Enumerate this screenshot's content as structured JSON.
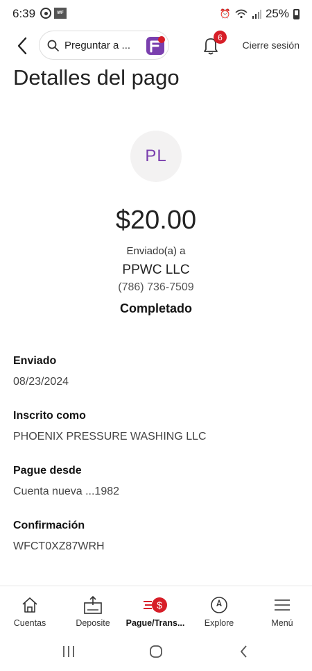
{
  "status_bar": {
    "time": "6:39",
    "wf_badge": "WF",
    "battery": "25%",
    "icons": [
      "whatsapp-icon",
      "wf-badge-icon",
      "alarm-icon",
      "wifi-icon",
      "signal-icon",
      "battery-icon"
    ]
  },
  "header": {
    "search_placeholder": "Preguntar a ...",
    "notification_count": "6",
    "logout_label": "Cierre sesión",
    "accent_color": "#d71e28",
    "fargo_color": "#7a3fae"
  },
  "page": {
    "title": "Detalles del pago"
  },
  "payment": {
    "avatar_initials": "PL",
    "amount": "$20.00",
    "sent_to_label": "Enviado(a) a",
    "payee_name": "PPWC LLC",
    "payee_phone": "(786) 736-7509",
    "status": "Completado"
  },
  "details": [
    {
      "label": "Enviado",
      "value": "08/23/2024"
    },
    {
      "label": "Inscrito como",
      "value": "PHOENIX PRESSURE WASHING LLC"
    },
    {
      "label": "Pague desde",
      "value": "Cuenta nueva ...1982"
    },
    {
      "label": "Confirmación",
      "value": "WFCT0XZ87WRH"
    }
  ],
  "bottom_nav": [
    {
      "label": "Cuentas",
      "icon": "home-icon"
    },
    {
      "label": "Deposite",
      "icon": "deposit-icon"
    },
    {
      "label": "Pague/Trans...",
      "icon": "pay-transfer-icon",
      "active": true
    },
    {
      "label": "Explore",
      "icon": "compass-icon"
    },
    {
      "label": "Menú",
      "icon": "menu-icon"
    }
  ]
}
